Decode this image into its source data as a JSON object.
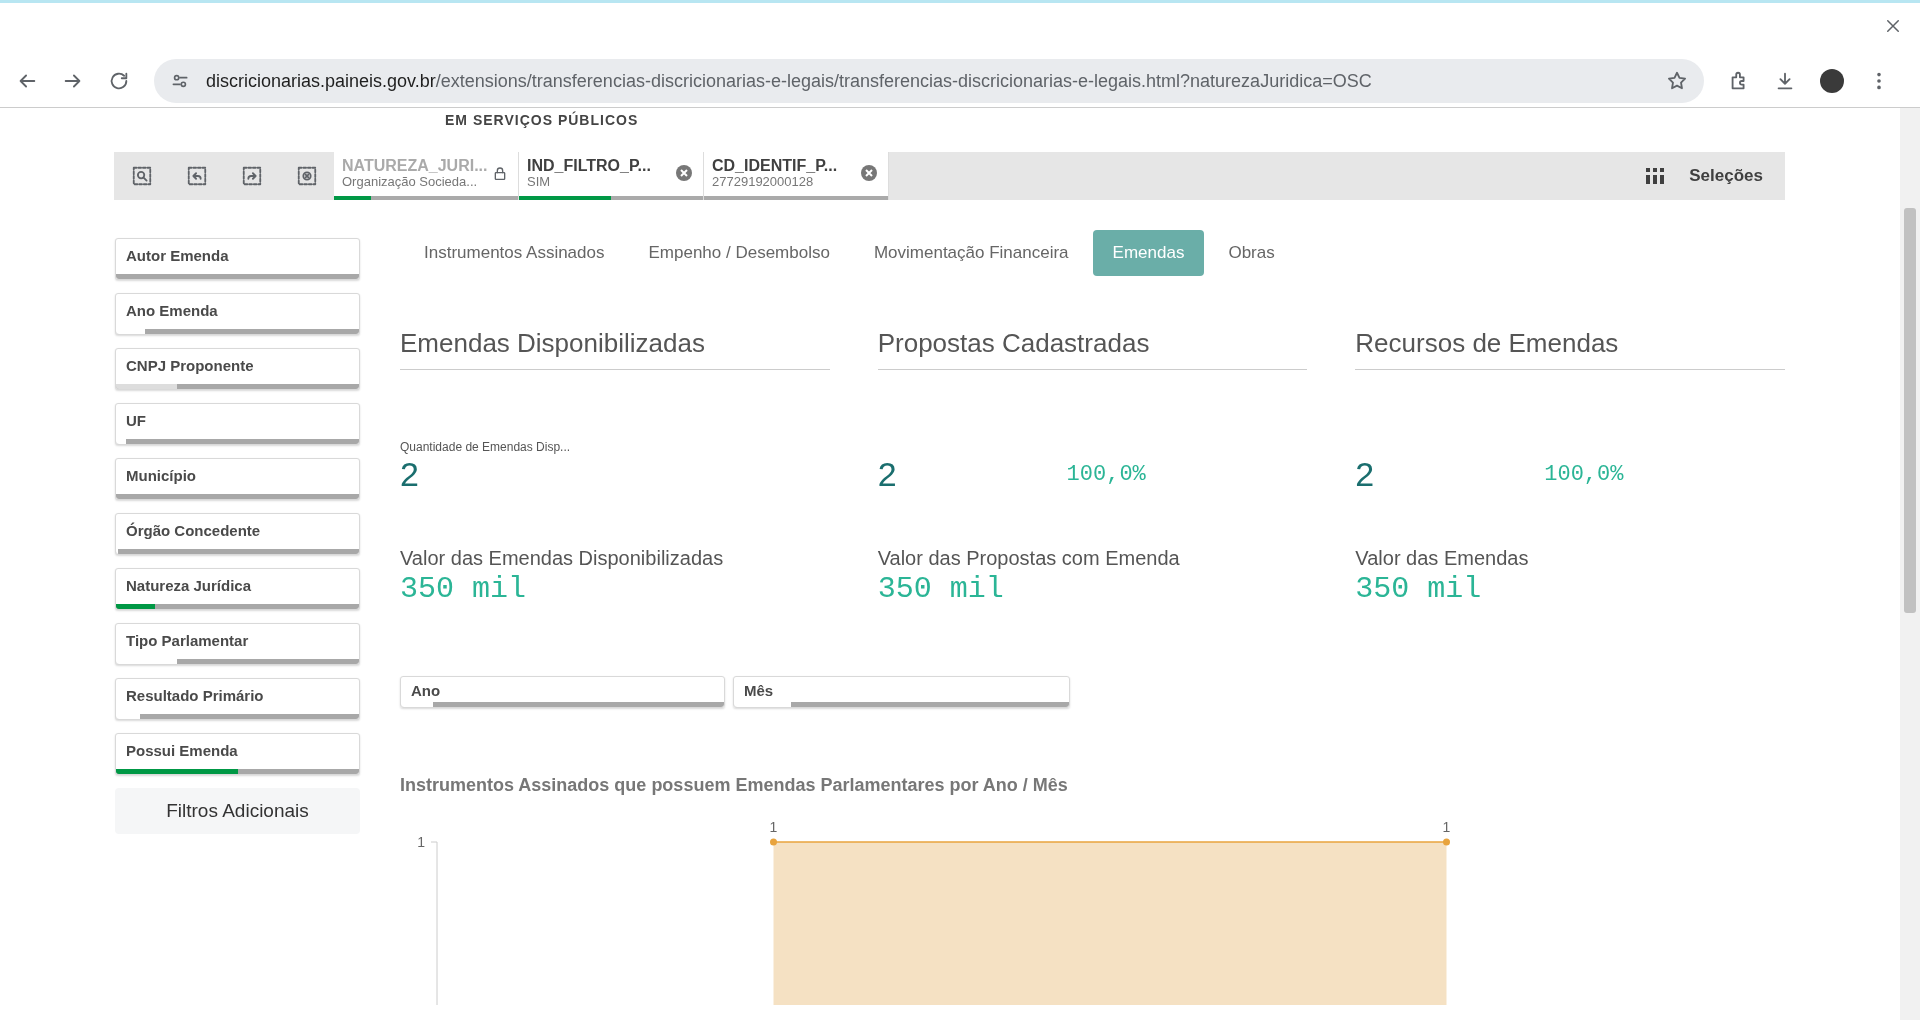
{
  "browser": {
    "url_host": "discricionarias.paineis.gov.br",
    "url_path": "/extensions/transferencias-discricionarias-e-legais/transferencias-discricionarias-e-legais.html?naturezaJuridica=OSC"
  },
  "header": {
    "subtitle": "EM SERVIÇOS PÚBLICOS"
  },
  "selection_bar": {
    "chips": [
      {
        "field": "NATUREZA_JURI...",
        "value": "Organização Socieda...",
        "locked": true,
        "level": 0.2
      },
      {
        "field": "IND_FILTRO_P...",
        "value": "SIM",
        "locked": false,
        "level": 0.5
      },
      {
        "field": "CD_IDENTIF_P...",
        "value": "27729192000128",
        "locked": false
      }
    ],
    "selections_label": "Seleções"
  },
  "sidebar": {
    "filters": [
      {
        "label": "Autor Emenda",
        "kind": "plain"
      },
      {
        "label": "Ano Emenda",
        "kind": "possible",
        "level": 0.12
      },
      {
        "label": "CNPJ Proponente",
        "kind": "alternative",
        "level": 0.25
      },
      {
        "label": "UF",
        "kind": "possible",
        "level": 0.04
      },
      {
        "label": "Município",
        "kind": "plain"
      },
      {
        "label": "Órgão Concedente",
        "kind": "possible",
        "level": 0.01
      },
      {
        "label": "Natureza Jurídica",
        "kind": "selected",
        "level": 0.16
      },
      {
        "label": "Tipo Parlamentar",
        "kind": "possible",
        "level": 0.25
      },
      {
        "label": "Resultado Primário",
        "kind": "possible",
        "level": 0.1
      },
      {
        "label": "Possui Emenda",
        "kind": "selected",
        "level": 0.5
      }
    ],
    "more_button": "Filtros Adicionais"
  },
  "tabs": [
    {
      "label": "Instrumentos Assinados",
      "selected": false
    },
    {
      "label": "Empenho / Desembolso",
      "selected": false
    },
    {
      "label": "Movimentação Financeira",
      "selected": false
    },
    {
      "label": "Emendas",
      "selected": true
    },
    {
      "label": "Obras",
      "selected": false
    }
  ],
  "kpi_sections": [
    {
      "title": "Emendas Disponibilizadas",
      "count_label": "Quantidade de Emendas Disp...",
      "count": "2",
      "value_label": "Valor das Emendas Disponibilizadas",
      "value": "350 mil"
    },
    {
      "title": "Propostas Cadastradas",
      "count": "2",
      "percent": "100,0%",
      "value_label": "Valor das Propostas com Emenda",
      "value": "350 mil"
    },
    {
      "title": "Recursos de Emendas",
      "count": "2",
      "percent": "100,0%",
      "value_label": "Valor das Emendas",
      "value": "350 mil"
    }
  ],
  "period_filters": [
    {
      "label": "Ano",
      "kind": "possible",
      "level": 0.1
    },
    {
      "label": "Mês",
      "kind": "possible",
      "level": 0.17
    }
  ],
  "chart": {
    "title": "Instrumentos Assinados que possuem Emendas Parlamentares por Ano / Mês",
    "y_axis_top_label": "1",
    "point_labels": [
      "1",
      "1"
    ]
  }
}
